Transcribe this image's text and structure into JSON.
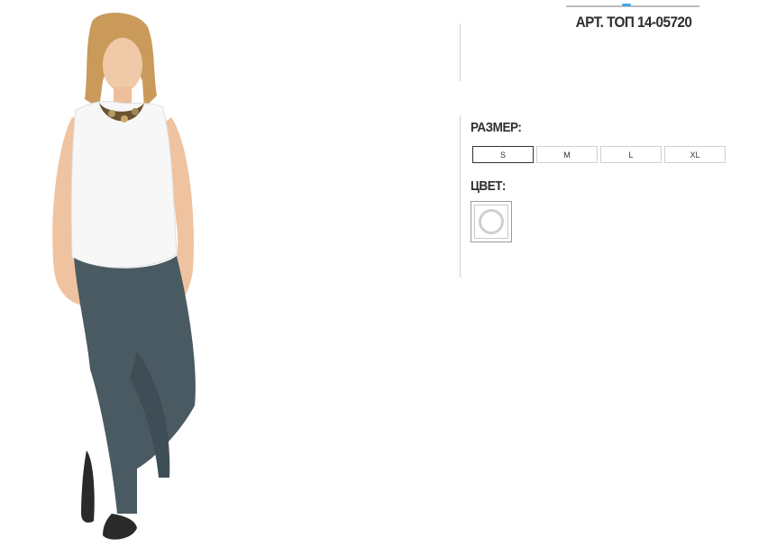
{
  "product": {
    "article_text": "АРТ. ТОП 14-05720",
    "image_alt": "model wearing white sleeveless top and dark grey trousers"
  },
  "options": {
    "size_label": "РАЗМЕР:",
    "sizes": [
      {
        "label": "S",
        "selected": true
      },
      {
        "label": "M",
        "selected": false
      },
      {
        "label": "L",
        "selected": false
      },
      {
        "label": "XL",
        "selected": false
      }
    ],
    "color_label": "ЦВЕТ:",
    "colors": [
      {
        "name": "white",
        "hex": "#ffffff",
        "selected": true
      }
    ]
  },
  "theme": {
    "accent": "#3da7e8",
    "text": "#2e2e2e",
    "trousers": "#4a5a62",
    "top": "#f6f6f6"
  }
}
